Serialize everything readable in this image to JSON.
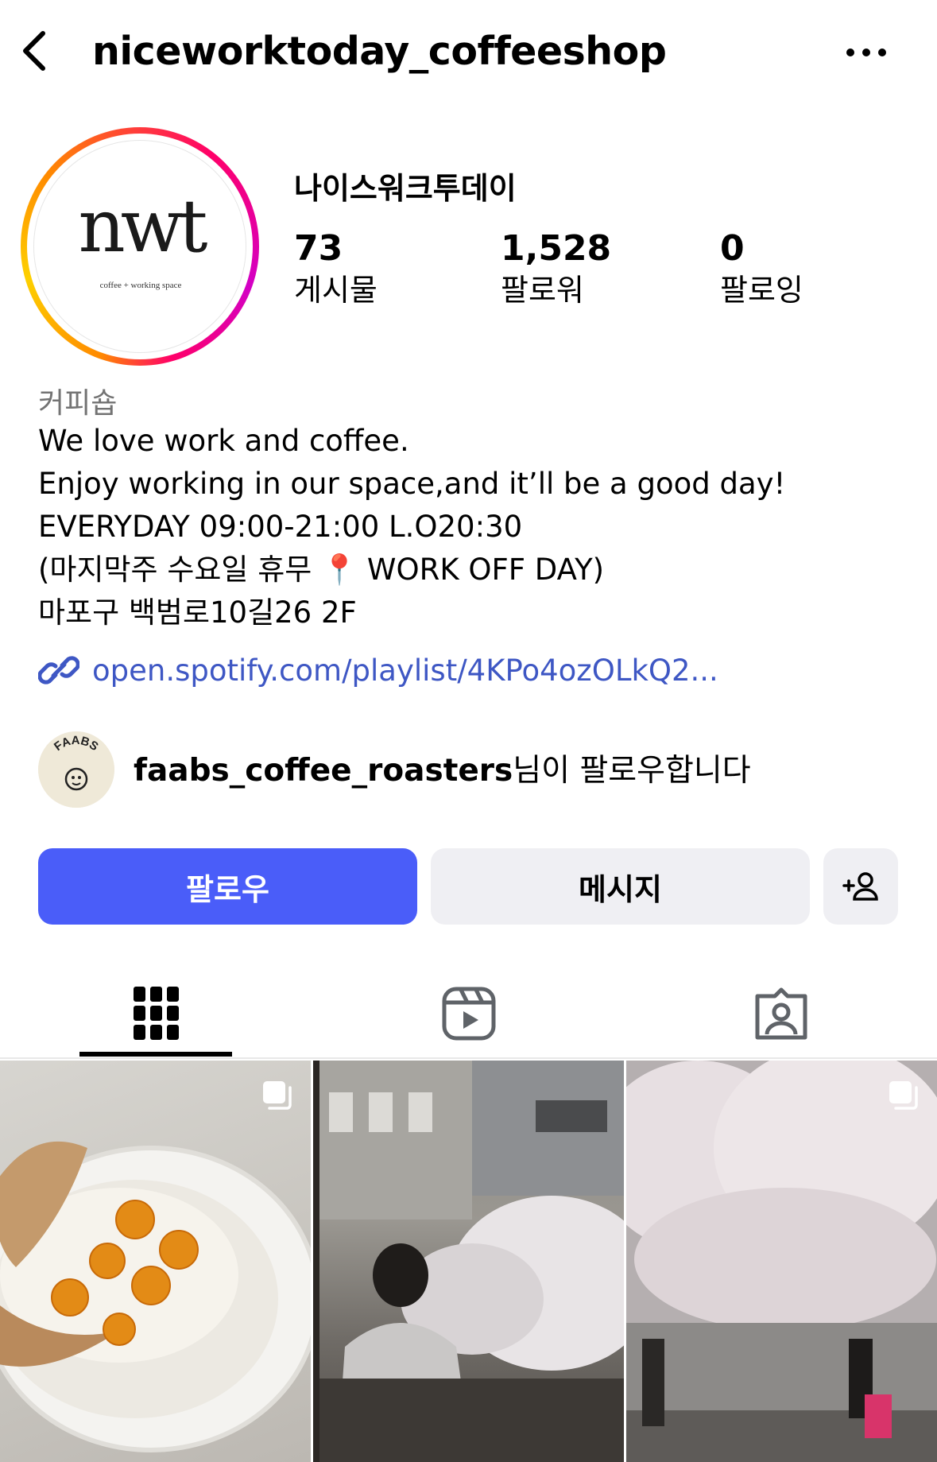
{
  "header": {
    "username": "niceworktoday_coffeeshop",
    "back_icon": "chevron-left-icon",
    "more_icon": "ellipsis-icon"
  },
  "profile": {
    "display_name": "나이스워크투데이",
    "avatar": {
      "logo_text": "nwt",
      "logo_subtext": "coffee + working space"
    },
    "stats": {
      "posts": {
        "value": "73",
        "label": "게시물"
      },
      "followers": {
        "value": "1,528",
        "label": "팔로워"
      },
      "following": {
        "value": "0",
        "label": "팔로잉"
      }
    },
    "category": "커피숍",
    "bio_lines": [
      "We love work and coffee.",
      "Enjoy working in our space,and it’ll be a good day!",
      "EVERYDAY 09:00-21:00 L.O20:30",
      "(마지막주 수요일 휴무 📍 WORK OFF DAY)",
      "마포구 백범로10길26 2F"
    ],
    "link": "open.spotify.com/playlist/4KPo4ozOLkQ2..."
  },
  "followed_by": {
    "username": "faabs_coffee_roasters",
    "suffix": "님이 팔로우합니다",
    "avatar_text": "FAABS"
  },
  "actions": {
    "follow_label": "팔로우",
    "message_label": "메시지",
    "add_person_icon": "add-person-icon"
  },
  "tabs": [
    {
      "name": "grid",
      "icon": "grid-icon",
      "active": true
    },
    {
      "name": "reels",
      "icon": "reels-icon",
      "active": false
    },
    {
      "name": "tagged",
      "icon": "tagged-icon",
      "active": false
    }
  ],
  "colors": {
    "follow_button": "#4a5df9",
    "secondary_button": "#efeff3",
    "link": "#3e57c4",
    "muted_text": "#737373"
  },
  "posts": [
    {
      "description_icon": "multiple-photos-icon",
      "multiple": true
    },
    {
      "multiple": false
    },
    {
      "description_icon": "multiple-photos-icon",
      "multiple": true
    }
  ]
}
